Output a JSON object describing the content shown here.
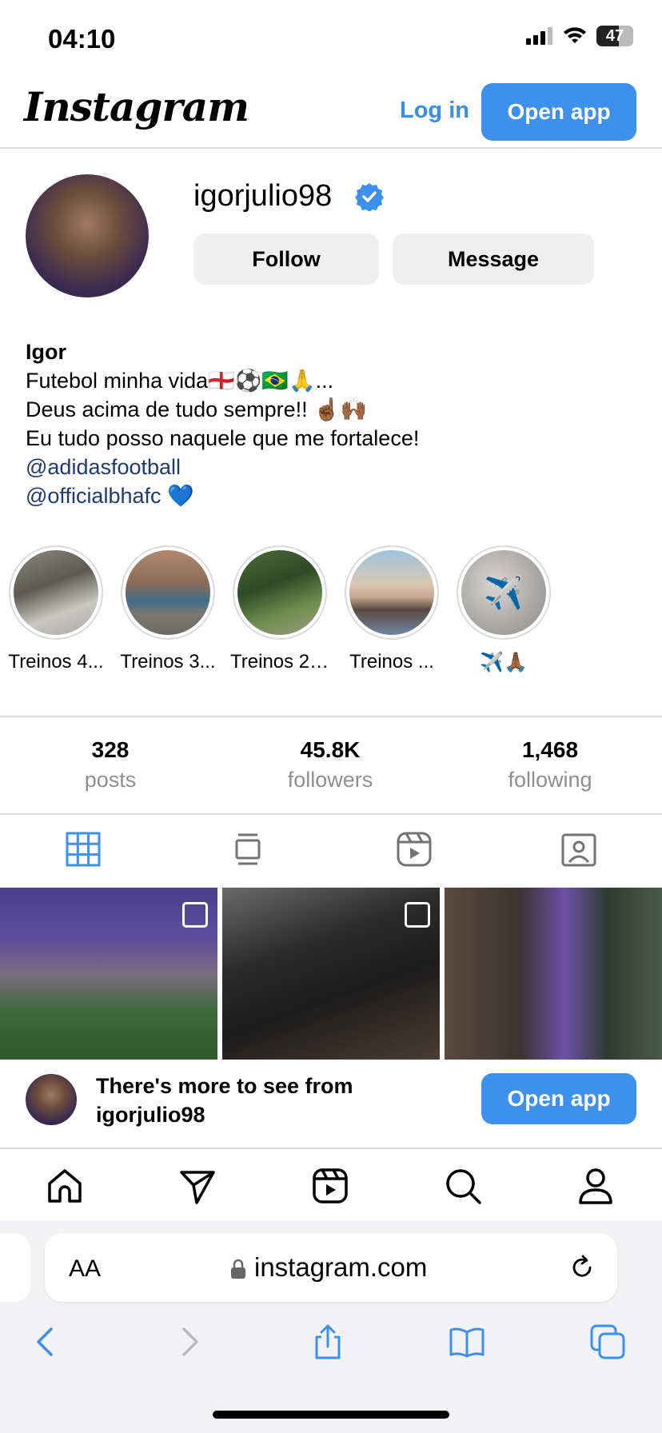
{
  "status_bar": {
    "time": "04:10",
    "battery": "47"
  },
  "header": {
    "logo": "Instagram",
    "login_label": "Log in",
    "open_app_label": "Open app"
  },
  "profile": {
    "username": "igorjulio98",
    "follow_label": "Follow",
    "message_label": "Message",
    "bio": {
      "name": "Igor",
      "line1": "Futebol minha vida🏴󠁧󠁢󠁥󠁮󠁧󠁿⚽🇧🇷🙏...",
      "line2": "Deus acima de tudo sempre!! ☝🏾🙌🏾",
      "line3": "Eu tudo posso naquele que me fortalece!",
      "mention1": "@adidasfootball",
      "mention2": "@officialbhafc",
      "heart": "💙"
    }
  },
  "highlights": [
    {
      "label": "Treinos 4..."
    },
    {
      "label": "Treinos 3..."
    },
    {
      "label": "Treinos 2 ..."
    },
    {
      "label": "Treinos ..."
    },
    {
      "label": "✈️🙏🏾"
    }
  ],
  "stats": [
    {
      "num": "328",
      "label": "posts"
    },
    {
      "num": "45.8K",
      "label": "followers"
    },
    {
      "num": "1,468",
      "label": "following"
    }
  ],
  "colors": {
    "accent": "#3d91ec",
    "link": "#1e3a6e",
    "muted": "#8e8e8e"
  },
  "banner": {
    "line1": "There's more to see from",
    "line2": "igorjulio98",
    "open_app_label": "Open app"
  },
  "safari": {
    "aa": "AA",
    "url": "instagram.com"
  }
}
